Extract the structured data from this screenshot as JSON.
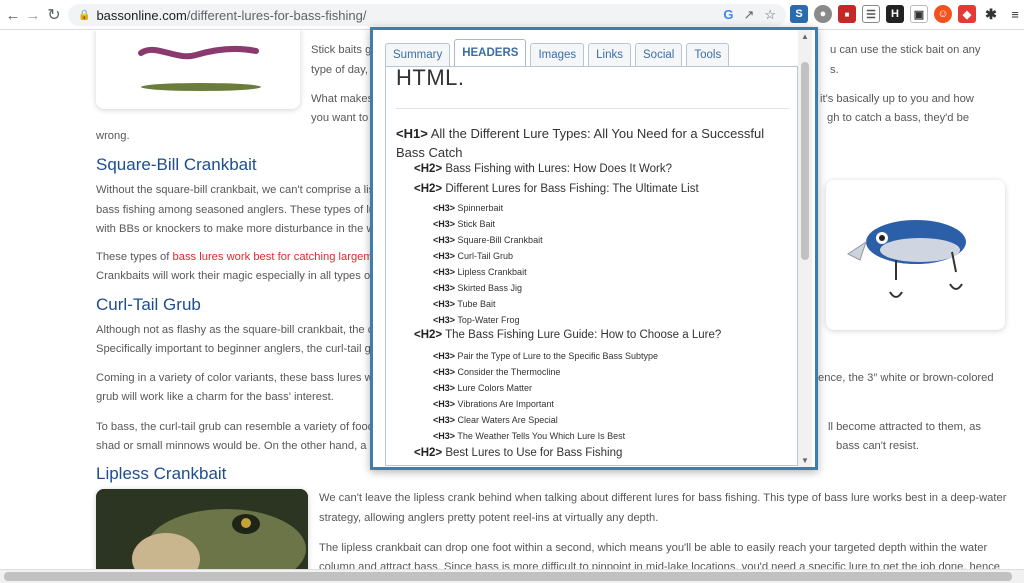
{
  "browser": {
    "url_host": "bassonline.com",
    "url_path": "/different-lures-for-bass-fishing/"
  },
  "article": {
    "p_stick1": "Stick baits g",
    "p_stick1b": "type of day, ",
    "p_stick1_right": "u can use the stick bait on any",
    "p_stick1_right2": "s.",
    "p_stick2": "What makes",
    "p_stick2b": "you want to",
    "p_stick2_right": " it's basically up to you and how",
    "p_stick2_right2": "gh to catch a bass, they'd be",
    "wrong": "wrong.",
    "h_square": "Square-Bill Crankbait",
    "p_sq1": "Without the square-bill crankbait, we can't comprise a lis",
    "p_sq2": "bass fishing among seasoned anglers. These types of lu",
    "p_sq3": "with BBs or knockers to make more disturbance in the w",
    "p_sq4_pre": "These types of ",
    "p_sq4_link": "bass lures work best for catching largem",
    "p_sq5": "Crankbaits will work their magic especially in all types of",
    "h_curl": "Curl-Tail Grub",
    "p_cu1": "Although not as flashy as the square-bill crankbait, the c",
    "p_cu2": "Specifically important to beginner anglers, the curl-tail gr",
    "p_cu3": "Coming in a variety of color variants, these bass lures w",
    "p_cu3_right": "ence, the 3″ white or brown-colored",
    "p_cu4": "grub will work like a charm for the bass' interest.",
    "p_cu5": "To bass, the curl-tail grub can resemble a variety of food",
    "p_cu5_right": "ll become attracted to them, as",
    "p_cu6": "shad or small minnows would be. On the other hand, a b",
    "p_cu6_right": "bass can't resist.",
    "h_lipless": "Lipless Crankbait",
    "p_li1": "We can't leave the lipless crank behind when talking about different lures for bass fishing. This type of bass lure works best in a deep-water",
    "p_li2": "strategy, allowing anglers pretty potent reel-ins at virtually any depth.",
    "p_li3": "The lipless crankbait can drop one foot within a second, which means you'll be able to easily reach your targeted depth within the water",
    "p_li4": "column and attract bass. Since bass is more difficult to pinpoint in mid-lake locations, you'd need a specific lure to get the job done, hence"
  },
  "popup": {
    "tabs": [
      "Summary",
      "HEADERS",
      "Images",
      "Links",
      "Social",
      "Tools"
    ],
    "active_tab": "HEADERS",
    "section_title": "HTML.",
    "headers": [
      {
        "level": "H1",
        "tag": "<H1>",
        "text": "All the Different Lure Types: All You Need for a Successful Bass Catch"
      },
      {
        "level": "H2",
        "tag": "<H2>",
        "text": "Bass Fishing with Lures: How Does It Work?"
      },
      {
        "level": "H2",
        "tag": "<H2>",
        "text": "Different Lures for Bass Fishing: The Ultimate List"
      },
      {
        "level": "H3",
        "tag": "<H3>",
        "text": "Spinnerbait"
      },
      {
        "level": "H3",
        "tag": "<H3>",
        "text": "Stick Bait"
      },
      {
        "level": "H3",
        "tag": "<H3>",
        "text": "Square-Bill Crankbait"
      },
      {
        "level": "H3",
        "tag": "<H3>",
        "text": "Curl-Tail Grub"
      },
      {
        "level": "H3",
        "tag": "<H3>",
        "text": "Lipless Crankbait"
      },
      {
        "level": "H3",
        "tag": "<H3>",
        "text": "Skirted Bass Jig"
      },
      {
        "level": "H3",
        "tag": "<H3>",
        "text": "Tube Bait"
      },
      {
        "level": "H3",
        "tag": "<H3>",
        "text": "Top-Water Frog"
      },
      {
        "level": "H2",
        "tag": "<H2>",
        "text": "The Bass Fishing Lure Guide: How to Choose a Lure?"
      },
      {
        "level": "H3",
        "tag": "<H3>",
        "text": "Pair the Type of Lure to the Specific Bass Subtype"
      },
      {
        "level": "H3",
        "tag": "<H3>",
        "text": "Consider the Thermocline"
      },
      {
        "level": "H3",
        "tag": "<H3>",
        "text": "Lure Colors Matter"
      },
      {
        "level": "H3",
        "tag": "<H3>",
        "text": "Vibrations Are Important"
      },
      {
        "level": "H3",
        "tag": "<H3>",
        "text": "Clear Waters Are Special"
      },
      {
        "level": "H3",
        "tag": "<H3>",
        "text": "The Weather Tells You Which Lure Is Best"
      },
      {
        "level": "H2",
        "tag": "<H2>",
        "text": "Best Lures to Use for Bass Fishing"
      }
    ]
  },
  "icons": {
    "back": "arrow-left-icon",
    "forward": "arrow-right-icon",
    "reload": "reload-icon",
    "lock": "lock-icon"
  },
  "colors": {
    "heading": "#1d4e8f",
    "link": "#e0292a",
    "popup_border": "#3a7fb0"
  }
}
